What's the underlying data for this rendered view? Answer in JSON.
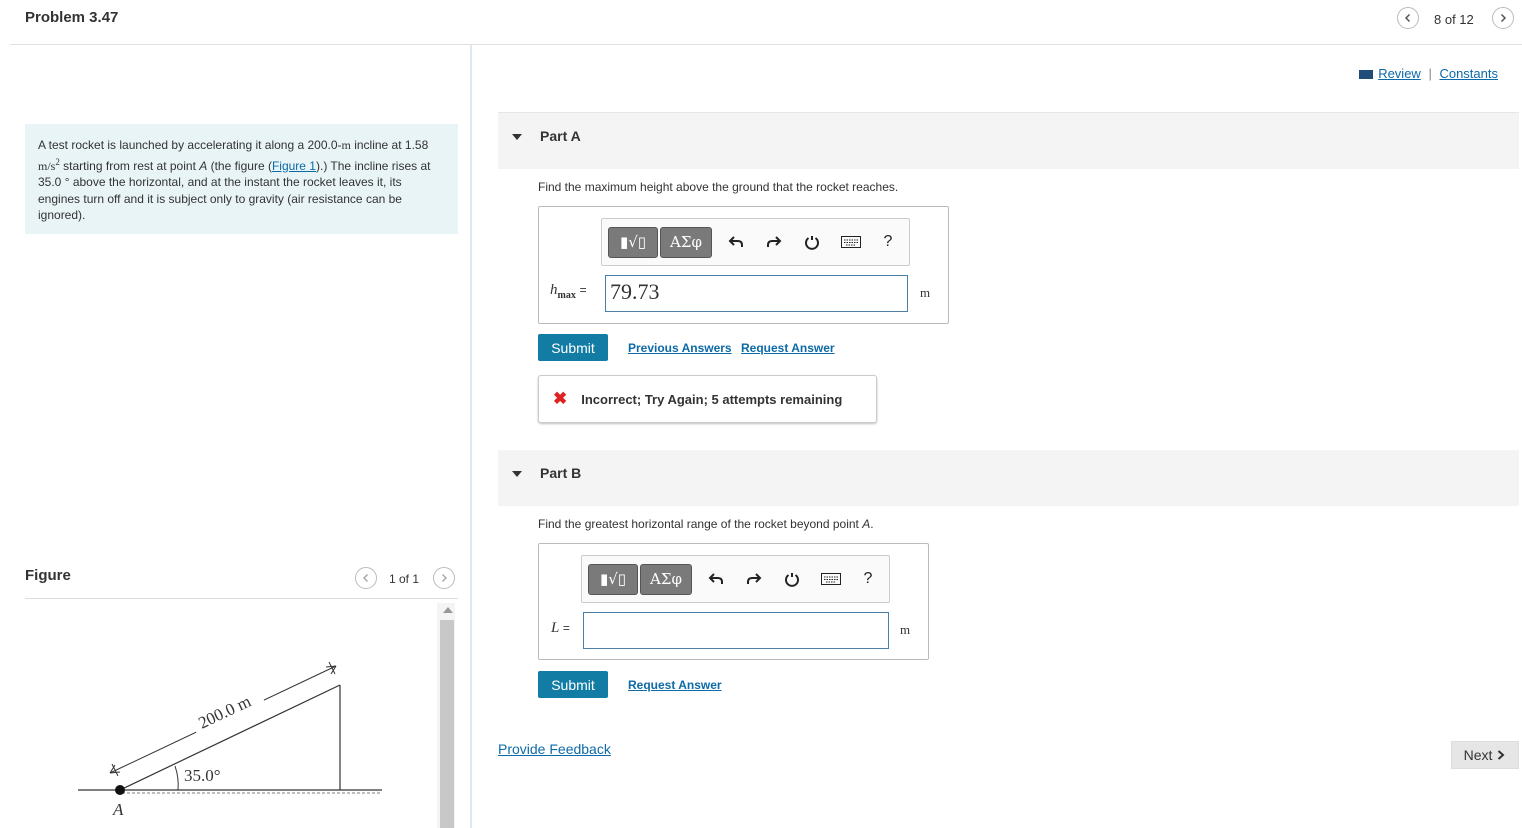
{
  "header": {
    "title": "Problem 3.47",
    "pager": "8 of 12"
  },
  "problem": {
    "text_1": "A test rocket is launched by accelerating it along a 200.0-",
    "unit_m": "m",
    "text_2": " incline at ",
    "accel_value": "1.58 ",
    "accel_unit": "m/s",
    "accel_exp": "2",
    "text_3": " starting from rest at point ",
    "point_a": "A",
    "text_4": " (the figure (",
    "figure_link": "Figure 1",
    "text_5": ").) The incline rises at 35.0 ° above the horizontal, and at the instant the rocket leaves it, its engines turn off and it is subject only to gravity (air resistance can be ignored)."
  },
  "figure": {
    "label": "Figure",
    "pager": "1 of 1",
    "length_label": "200.0 m",
    "angle_label": "35.0°",
    "point_label": "A"
  },
  "links": {
    "review": "Review",
    "separator": "|",
    "constants": "Constants"
  },
  "part_a": {
    "title": "Part A",
    "question": "Find the maximum height above the ground that the rocket reaches.",
    "var_main": "h",
    "var_sub": "max",
    "equals": "=",
    "value": "79.73",
    "unit": "m",
    "submit": "Submit",
    "previous_answers": "Previous Answers",
    "request_answer": "Request Answer",
    "feedback": "Incorrect; Try Again; 5 attempts remaining"
  },
  "part_b": {
    "title": "Part B",
    "question_1": "Find the greatest horizontal range of the rocket beyond point ",
    "question_point": "A",
    "question_2": ".",
    "var_main": "L",
    "equals": "=",
    "value": "",
    "unit": "m",
    "submit": "Submit",
    "request_answer": "Request Answer"
  },
  "toolbar": {
    "templates_label": "▮√▯",
    "greek_label": "ΑΣφ",
    "help": "?"
  },
  "footer": {
    "provide_feedback": "Provide Feedback",
    "next": "Next"
  },
  "colors": {
    "accent": "#127ca4",
    "link": "#0d6aa8",
    "problem_bg": "#e8f4f6",
    "error": "#dd2222"
  }
}
